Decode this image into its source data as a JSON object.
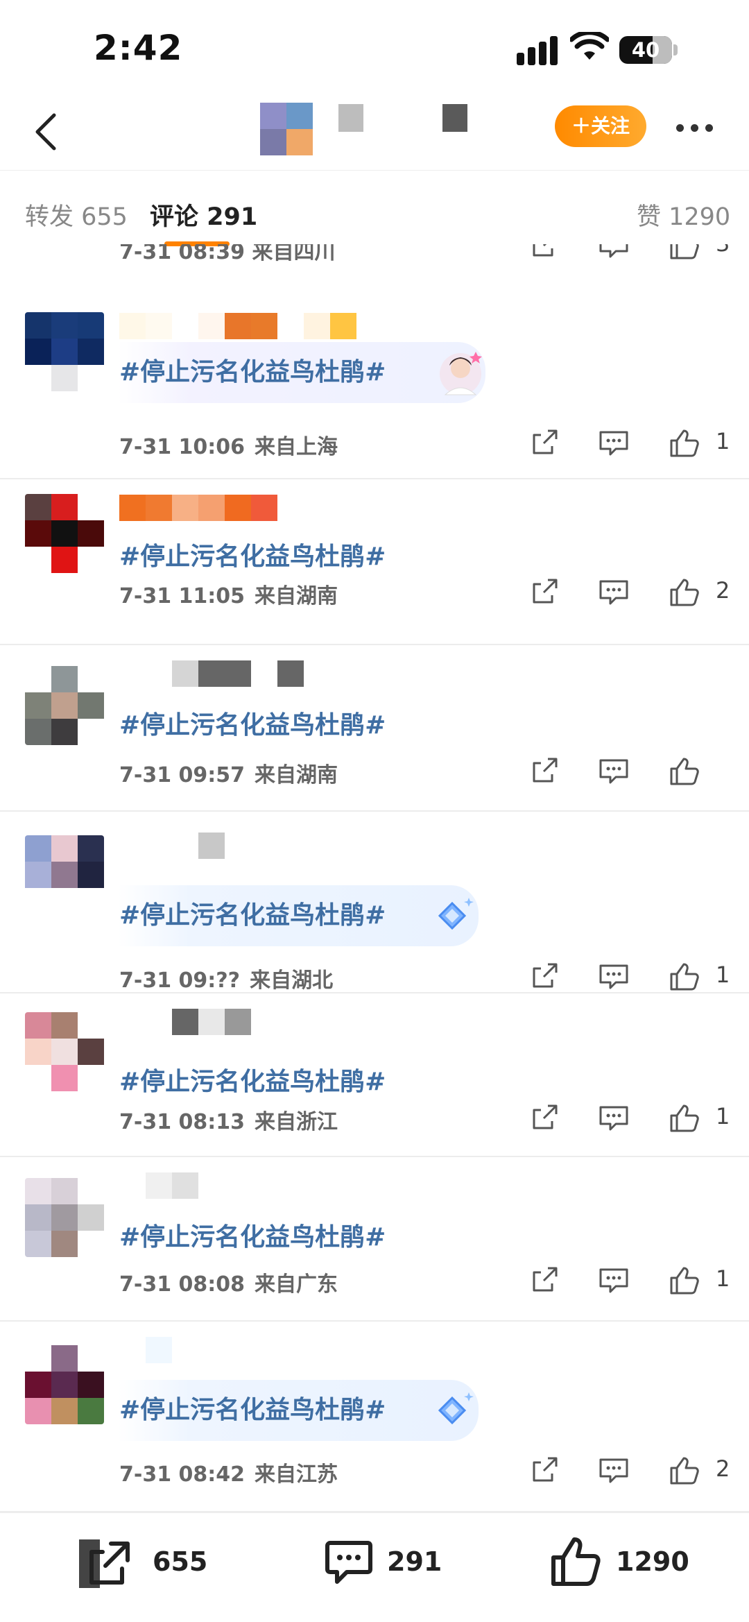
{
  "status_bar": {
    "time": "2:42",
    "battery": "40"
  },
  "nav": {
    "follow_label": "＋关注"
  },
  "tabs": {
    "repost": "转发 655",
    "comments": "评论 291",
    "likes": "赞 1290"
  },
  "partial_row": {
    "meta": "7-31 08:39 来自四川",
    "like_count": "3"
  },
  "comments": [
    {
      "text": "#停止污名化益鸟杜鹃#",
      "date": "7-31 10:06",
      "location": "来自上海",
      "likes": "1",
      "avatar": [
        "#15346b",
        "#1a3c7a",
        "#173a76",
        "#0a2258",
        "#1d3d85",
        "#0f2a61",
        "#ffffff",
        "#e6e6e8",
        "#ffffff"
      ],
      "name_colors": [
        "#fff8e8",
        "#fffaf0",
        "#ffffff",
        "#fff6ee",
        "#e8762a",
        "#e87a2a",
        "#ffffff",
        "#fff3e0",
        "#ffc542"
      ]
    },
    {
      "text": "#停止污名化益鸟杜鹃#",
      "date": "7-31 11:05",
      "location": "来自湖南",
      "likes": "2",
      "avatar": [
        "#5a4040",
        "#d81e1e",
        "#ffffff",
        "#5a0a0a",
        "#111111",
        "#4a0a0a",
        "#ffffff",
        "#e01414",
        "#ffffff"
      ],
      "name_colors": [
        "#f07020",
        "#f07a30",
        "#f7b085",
        "#f5a070",
        "#f06a20",
        "#f05a3a"
      ]
    },
    {
      "text": "#停止污名化益鸟杜鹃#",
      "date": "7-31 09:57",
      "location": "来自湖南",
      "likes": "",
      "avatar": [
        "#ffffff",
        "#8e9698",
        "#ffffff",
        "#7e8278",
        "#c0a08e",
        "#727870",
        "#6a6e6c",
        "#3e3c3e",
        "#ffffff"
      ],
      "name_colors": [
        "#ffffff",
        "#ffffff",
        "#d5d5d5",
        "#666666",
        "#666666",
        "#ffffff",
        "#666666"
      ]
    },
    {
      "text": "#停止污名化益鸟杜鹃#",
      "date": "7-31 09:??",
      "location": "来自湖北",
      "likes": "1",
      "avatar": [
        "#8ea0d0",
        "#e8c8d0",
        "#2a3050",
        "#a8b0d8",
        "#907890",
        "#202440",
        "#ffffff",
        "#ffffff",
        "#ffffff"
      ],
      "name_colors": [
        "#ffffff",
        "#ffffff",
        "#ffffff",
        "#c8c8c8"
      ]
    },
    {
      "text": "#停止污名化益鸟杜鹃#",
      "date": "7-31 08:13",
      "location": "来自浙江",
      "likes": "1",
      "avatar": [
        "#d88898",
        "#a88070",
        "#ffffff",
        "#f8d4c8",
        "#f0e0e0",
        "#5a4040",
        "#ffffff",
        "#f090b0",
        "#ffffff"
      ],
      "name_colors": [
        "#ffffff",
        "#ffffff",
        "#666666",
        "#e8e8e8",
        "#999999"
      ]
    },
    {
      "text": "#停止污名化益鸟杜鹃#",
      "date": "7-31 08:08",
      "location": "来自广东",
      "likes": "1",
      "avatar": [
        "#e8e0e8",
        "#d8d0d8",
        "#ffffff",
        "#b8b8c8",
        "#a09aa0",
        "#d0d0d0",
        "#c8c8d8",
        "#a08880",
        "#ffffff"
      ],
      "name_colors": [
        "#ffffff",
        "#f0f0f0",
        "#e0e0e0"
      ]
    },
    {
      "text": "#停止污名化益鸟杜鹃#",
      "date": "7-31 08:42",
      "location": "来自江苏",
      "likes": "2",
      "avatar": [
        "#ffffff",
        "#8a6a88",
        "#ffffff",
        "#6a1030",
        "#5a2a50",
        "#3a1020",
        "#e890b0",
        "#c09060",
        "#4a7a40"
      ],
      "name_colors": [
        "#ffffff",
        "#f0f8ff",
        "#ffffff"
      ]
    }
  ],
  "bottom_bar": {
    "repost": "655",
    "comment": "291",
    "like": "1290"
  }
}
